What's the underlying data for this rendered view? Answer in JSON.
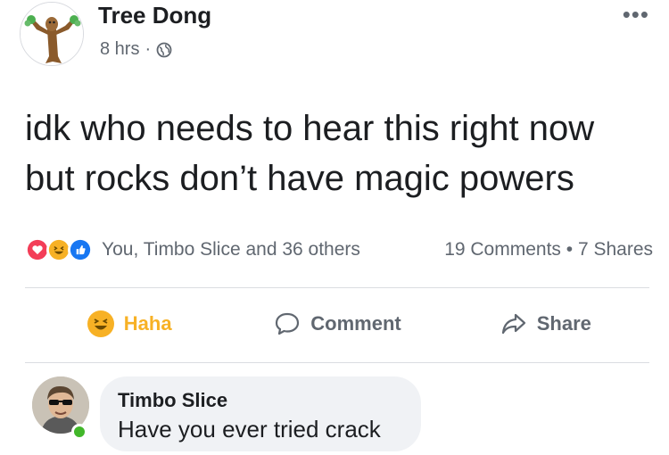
{
  "post": {
    "author": "Tree Dong",
    "time": "8 hrs",
    "separator": "·",
    "more_label": "•••",
    "text": "idk who needs to hear this right now but rocks don’t have magic powers"
  },
  "reactions": {
    "summary": "You, Timbo Slice and 36 others",
    "counts": "19 Comments • 7 Shares"
  },
  "actions": {
    "haha": "Haha",
    "comment": "Comment",
    "share": "Share"
  },
  "comment": {
    "author": "Timbo Slice",
    "text": "Have you ever tried crack"
  },
  "colors": {
    "haha": "#f7b125",
    "like": "#1877f2",
    "love": "#f33e58",
    "secondary_text": "#606770",
    "online": "#42b72a"
  }
}
